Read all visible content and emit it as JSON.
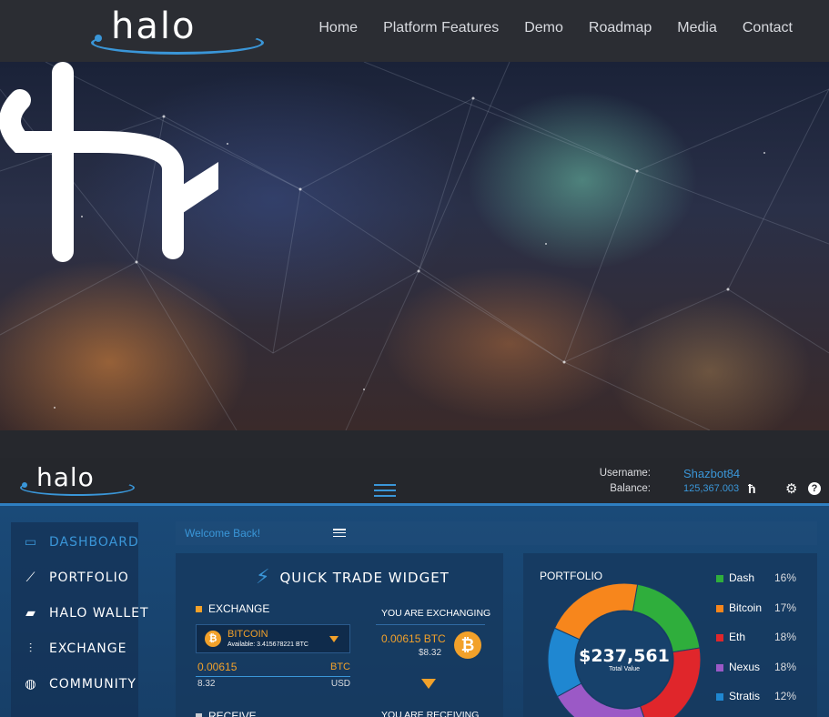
{
  "site": {
    "logo_text": "halo",
    "nav": [
      "Home",
      "Platform Features",
      "Demo",
      "Roadmap",
      "Media",
      "Contact"
    ]
  },
  "app": {
    "logo_text": "halo",
    "username_label": "Username:",
    "balance_label": "Balance:",
    "username": "Shazbot84",
    "balance": "125,367.003",
    "sidebar": [
      {
        "label": "DASHBOARD",
        "icon": "dashboard-icon",
        "active": true
      },
      {
        "label": "PORTFOLIO",
        "icon": "portfolio-icon",
        "active": false
      },
      {
        "label": "HALO WALLET",
        "icon": "wallet-icon",
        "active": false
      },
      {
        "label": "EXCHANGE",
        "icon": "exchange-icon",
        "active": false
      },
      {
        "label": "COMMUNITY",
        "icon": "globe-icon",
        "active": false
      }
    ],
    "welcome": "Welcome Back!",
    "quick_trade": {
      "title": "QUICK TRADE WIDGET",
      "exchange_label": "EXCHANGE",
      "coin_name": "BITCOIN",
      "available": "Available: 3.415678221 BTC",
      "amount": "0.00615",
      "amount_currency": "BTC",
      "usd_amount": "8.32",
      "usd_currency": "USD",
      "receive_label": "RECEIVE",
      "exchanging_header": "YOU ARE EXCHANGING",
      "exchanging_btc": "0.00615 BTC",
      "exchanging_usd": "$8.32",
      "receiving_header": "YOU ARE RECEIVING"
    },
    "portfolio": {
      "title": "PORTFOLIO",
      "total": "$237,561",
      "total_label": "Total Value"
    }
  },
  "colors": {
    "accent": "#3a96d8",
    "bitcoin": "#f2a12a"
  },
  "chart_data": {
    "type": "pie",
    "categories": [
      "Dash",
      "Bitcoin",
      "Eth",
      "Nexus",
      "Stratis"
    ],
    "values": [
      16,
      17,
      18,
      18,
      12
    ],
    "labels": [
      "16%",
      "17%",
      "18%",
      "18%",
      "12%"
    ],
    "colors": [
      "#2fae3c",
      "#f7861c",
      "#e0262b",
      "#9b59c6",
      "#1f87d1"
    ],
    "title": "PORTFOLIO"
  }
}
